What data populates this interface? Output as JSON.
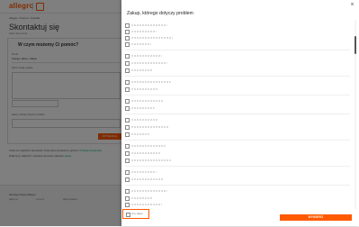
{
  "header": {
    "logo": "allegro"
  },
  "breadcrumb": "Allegro  ›  Pomoc  ›  Kontakt",
  "page": {
    "title": "Skontaktuj się",
    "contact_link": "Zapis dany formie",
    "card_heading": "W czym możemy Ci pomóc?",
    "topic_label": "Temat",
    "topic_value": "Zamówienie",
    "category_label": "Kupuję i płacę › Zakup",
    "description_label": "Wpisz swoje pytanie",
    "problem_label": "Zakup, którego dotyczy problem",
    "next_button": "WYSZUKAJ",
    "footer_text_1": "Jeżeli nie znajdziesz odpowiedzi, Twoje dane przekażemy zgodnie z",
    "footer_link_1": "Polityką Prywatności",
    "footer_text_2": "Dołączymy załącznik z zapisaną rozmową i zakupem",
    "footer_link_2": "więcej"
  },
  "footer": {
    "heading": "Serwisy Grupy Allegro",
    "links": [
      "allegro.pl",
      "ceneo.pl",
      "allegro lokalnie"
    ]
  },
  "drawer": {
    "title": "Zakup, którego dotyczy problem",
    "close_label": "×",
    "other_label": "Inny zakup",
    "select_button": "WYBIERZ"
  },
  "colors": {
    "brand": "#ff5a00",
    "overlay": "rgba(0,0,0,0.5)"
  }
}
